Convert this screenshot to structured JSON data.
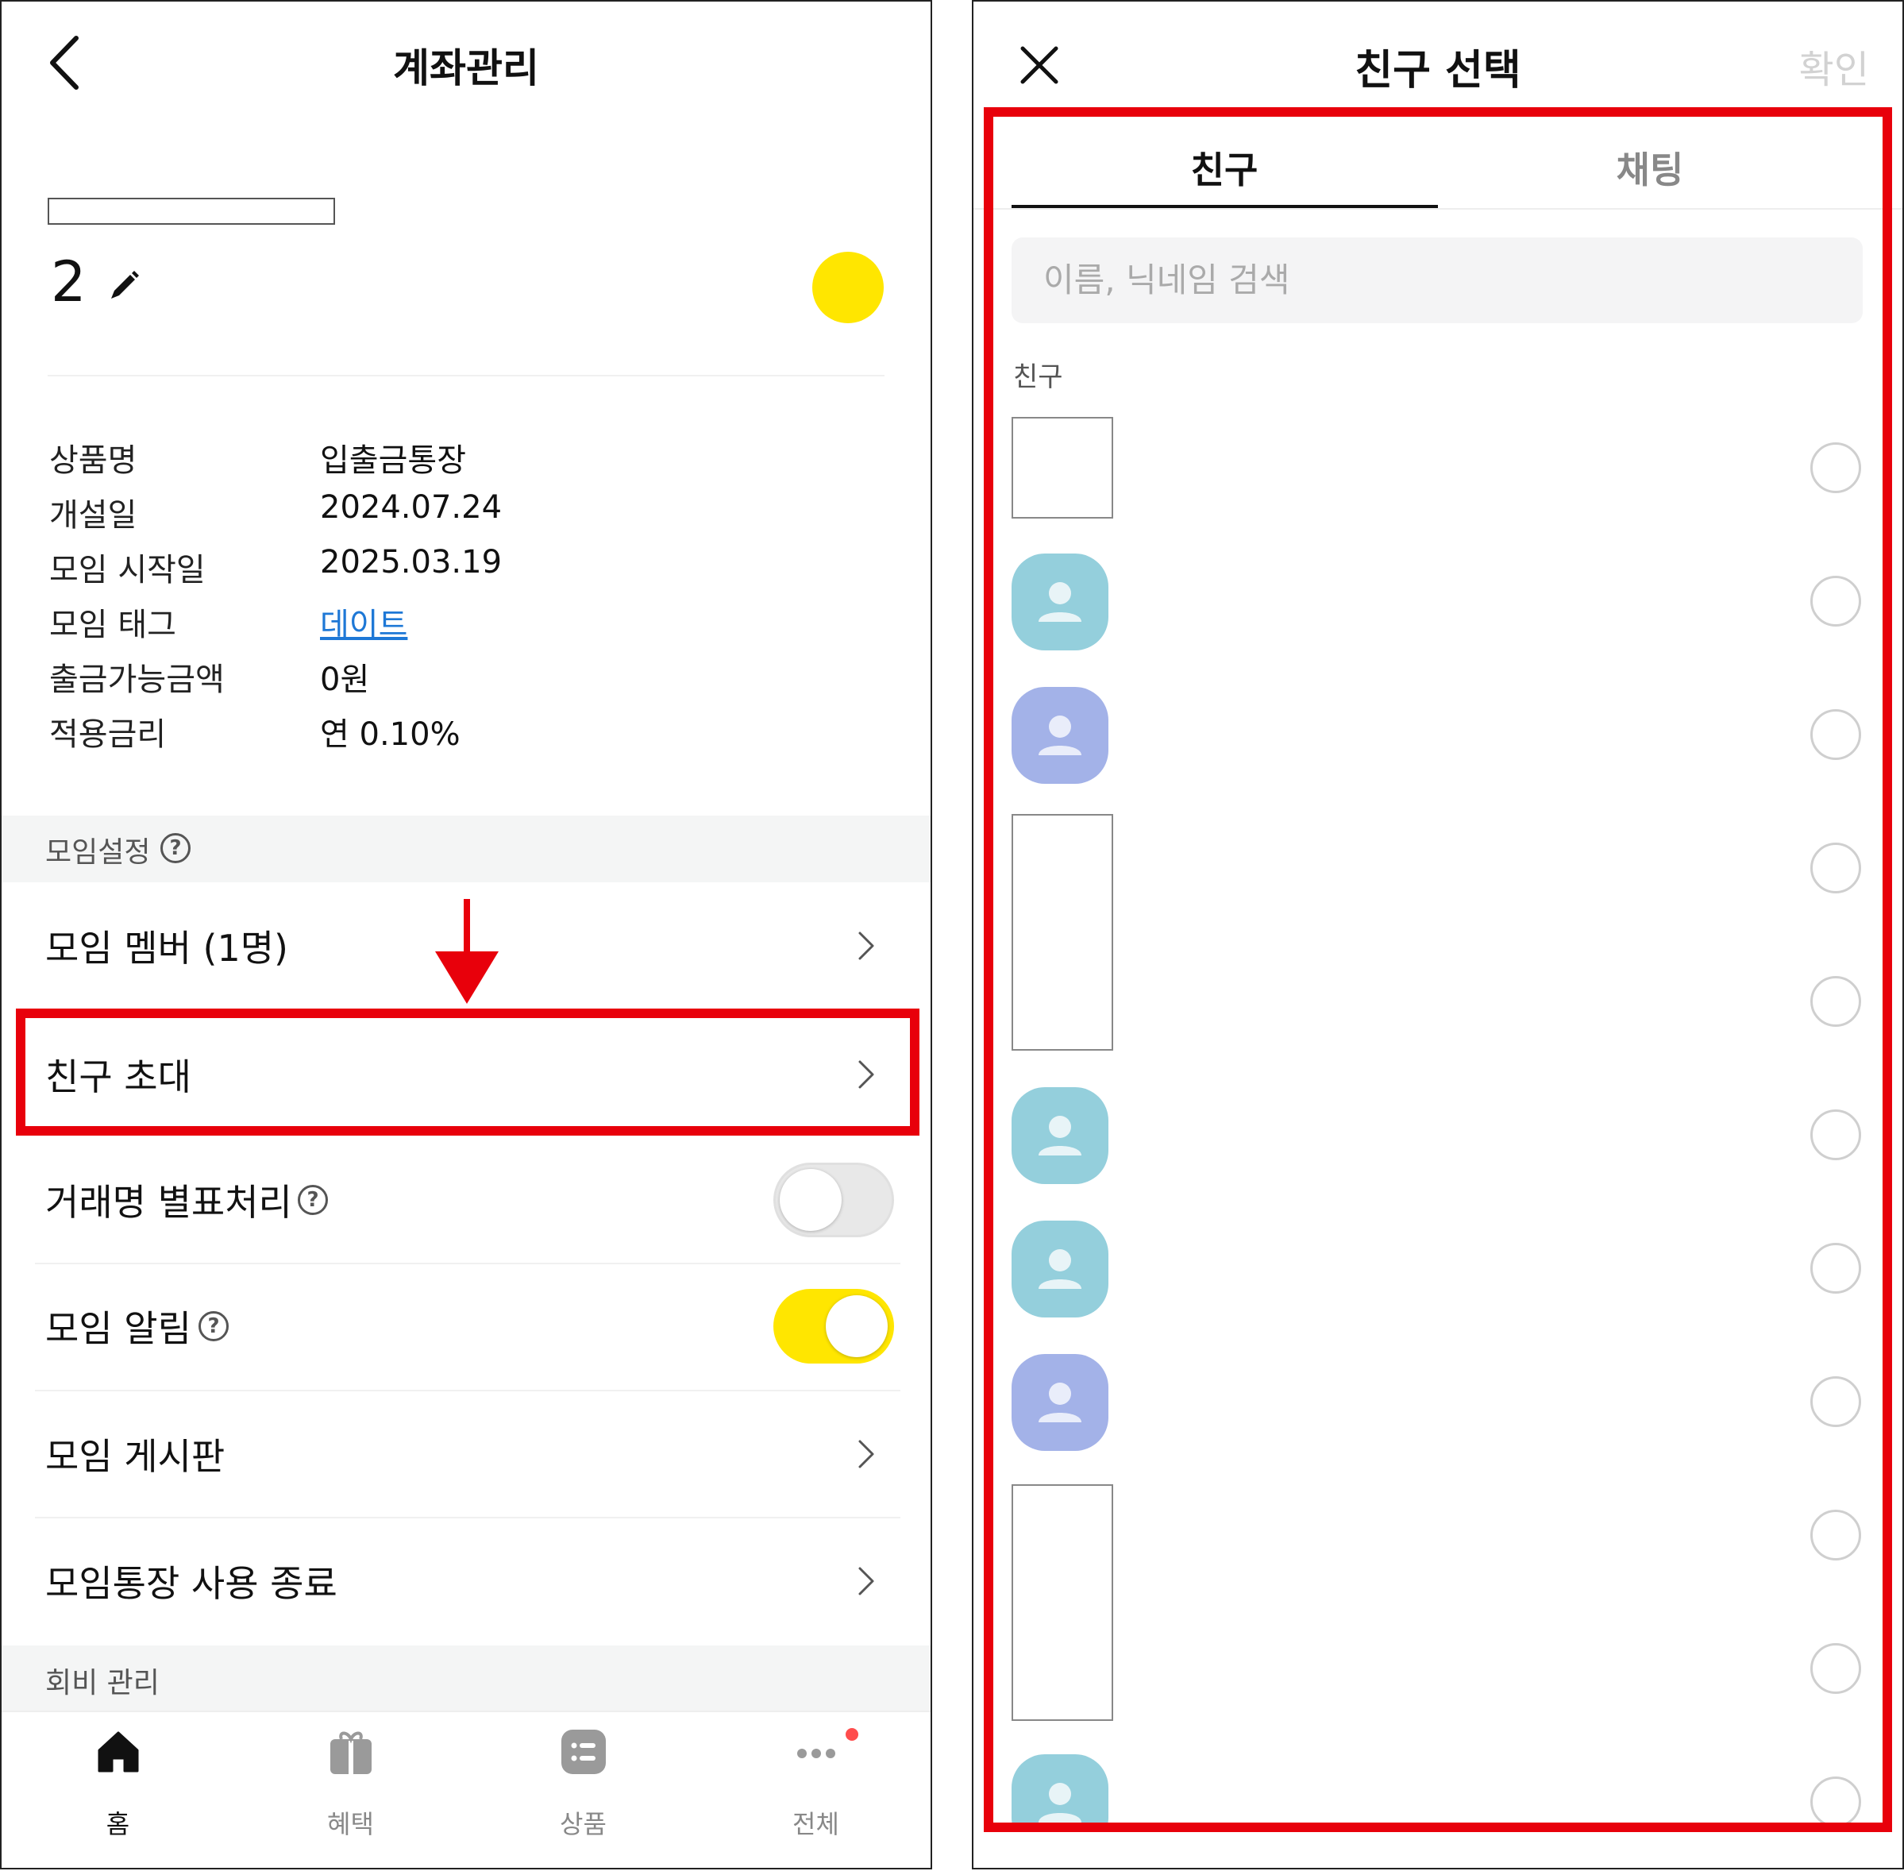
{
  "left": {
    "header": {
      "title": "계좌관리",
      "back_icon": "chevron-left-icon"
    },
    "account": {
      "number": "2",
      "edit_icon": "pencil-icon",
      "color": "#ffe600"
    },
    "info": [
      {
        "label": "상품명",
        "value": "입출금통장"
      },
      {
        "label": "개설일",
        "value": "2024.07.24"
      },
      {
        "label": "모임 시작일",
        "value": "2025.03.19"
      },
      {
        "label": "모임 태그",
        "value": "데이트",
        "is_link": true
      },
      {
        "label": "출금가능금액",
        "value": "0원"
      },
      {
        "label": "적용금리",
        "value": "연 0.10%"
      }
    ],
    "section_settings": {
      "label": "모임설정",
      "help": "?"
    },
    "menu": {
      "members": {
        "label": "모임 멤버 (1명)"
      },
      "invite": {
        "label": "친구 초대"
      },
      "alias": {
        "label": "거래명 별표처리",
        "help": "?",
        "toggle_on": false
      },
      "alerts": {
        "label": "모임 알림",
        "help": "?",
        "toggle_on": true
      },
      "board": {
        "label": "모임 게시판"
      },
      "end": {
        "label": "모임통장 사용 종료"
      }
    },
    "section_fees": {
      "label": "회비 관리"
    },
    "tabbar": [
      {
        "label": "홈",
        "icon": "home-icon",
        "active": true
      },
      {
        "label": "혜택",
        "icon": "gift-icon",
        "active": false
      },
      {
        "label": "상품",
        "icon": "list-icon",
        "active": false
      },
      {
        "label": "전체",
        "icon": "more-dots-icon",
        "active": false
      }
    ],
    "annotation_color": "#e8000b"
  },
  "right": {
    "header": {
      "title": "친구 선택",
      "confirm_label": "확인",
      "close_icon": "close-icon"
    },
    "tabs": [
      {
        "label": "친구",
        "active": true
      },
      {
        "label": "채팅",
        "active": false
      }
    ],
    "search": {
      "placeholder": "이름, 닉네임 검색"
    },
    "friends_section_label": "친구",
    "friends": [
      {
        "avatar": "placeholder-box"
      },
      {
        "avatar": "teal"
      },
      {
        "avatar": "purple"
      },
      {
        "avatar": "placeholder-box-tall"
      },
      {
        "avatar": "placeholder-box-tall"
      },
      {
        "avatar": "teal"
      },
      {
        "avatar": "teal"
      },
      {
        "avatar": "purple"
      },
      {
        "avatar": "placeholder-box-tall"
      },
      {
        "avatar": "placeholder-box-tall"
      },
      {
        "avatar": "teal"
      }
    ]
  }
}
